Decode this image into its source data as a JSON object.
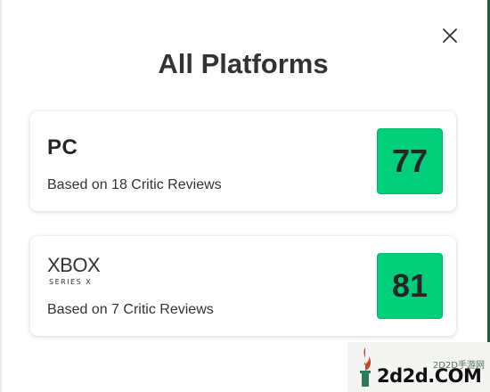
{
  "modal": {
    "title": "All Platforms",
    "close_icon": "close-icon"
  },
  "platforms": [
    {
      "name": "PC",
      "reviews_text": "Based on 18 Critic Reviews",
      "score": "77",
      "score_color": "#00ce7a"
    },
    {
      "name": "XBOX",
      "sub_name": "SERIES X",
      "reviews_text": "Based on 7 Critic Reviews",
      "score": "81",
      "score_color": "#00ce7a"
    }
  ],
  "watermark": {
    "cn_text": "2D2D手游网",
    "url_text": "2d2d.COM"
  }
}
